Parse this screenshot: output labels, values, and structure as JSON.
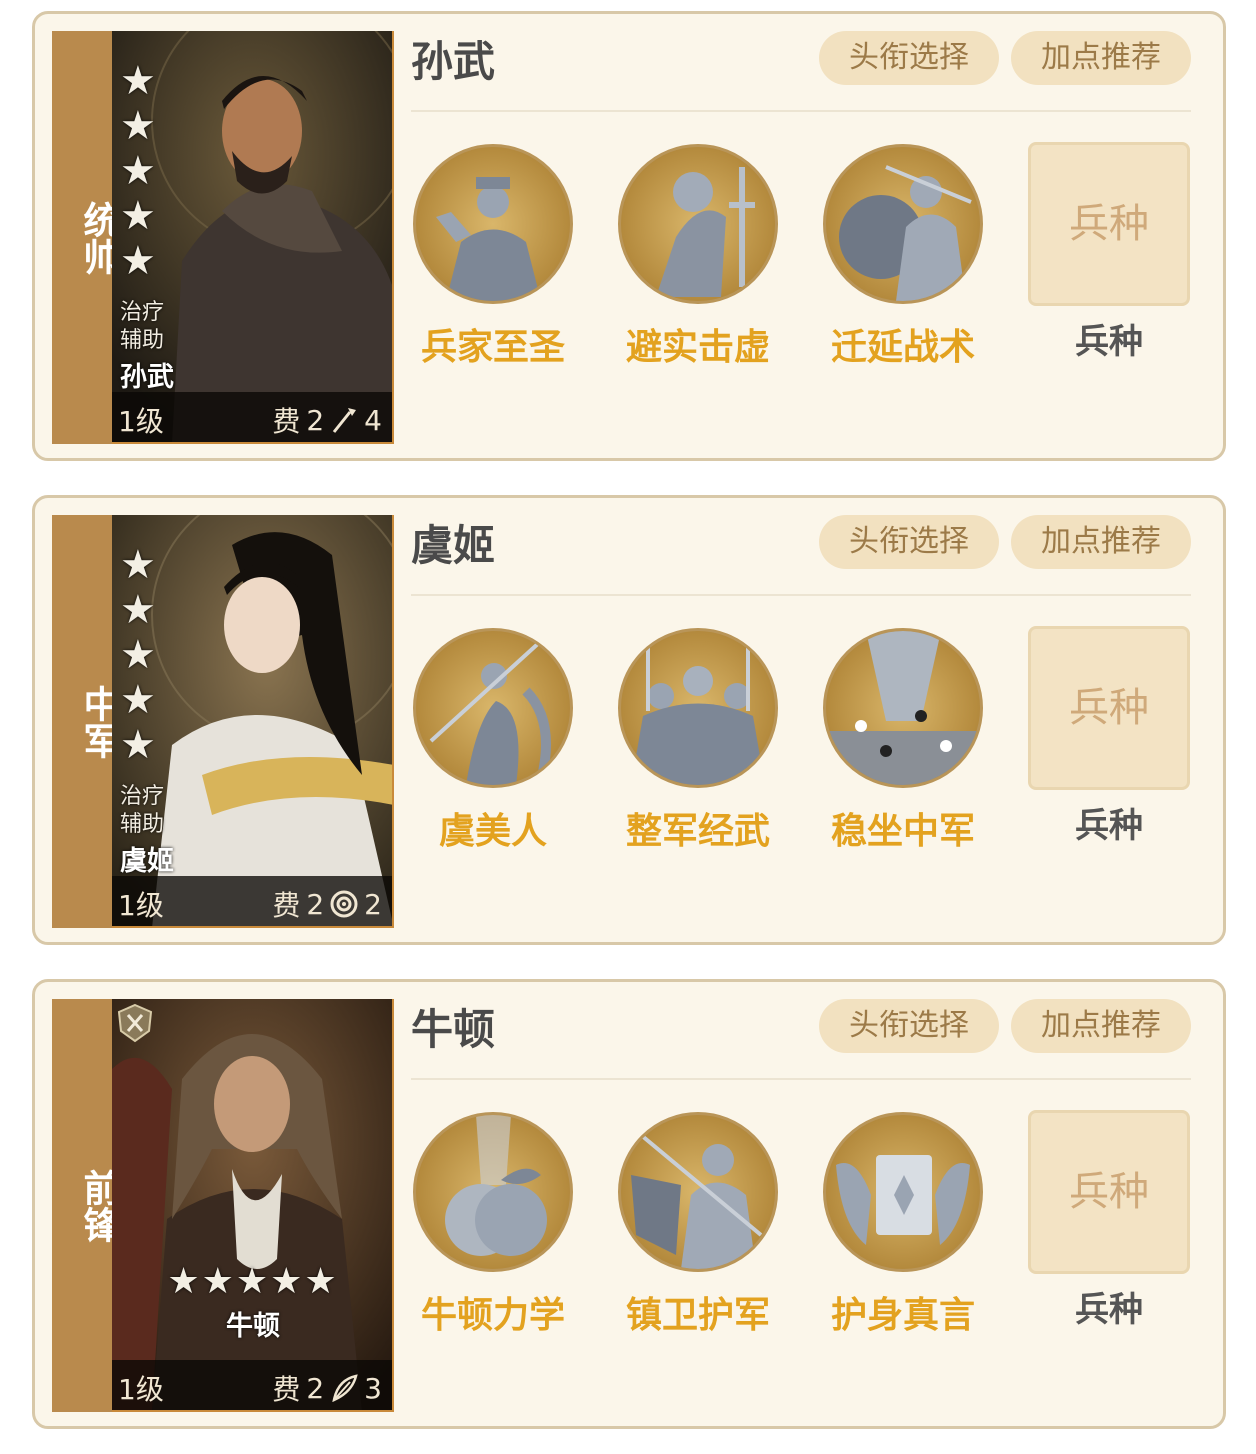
{
  "common": {
    "title_button": "头衔选择",
    "points_button": "加点推荐",
    "troop_box": "兵种",
    "troop_label": "兵种"
  },
  "heroes": [
    {
      "role": "统帅",
      "name": "孙武",
      "portrait_tags": [
        "治疗",
        "辅助"
      ],
      "portrait_name": "孙武",
      "level": "1级",
      "cost_label": "费",
      "cost": "2",
      "unit_icon": "spear-icon",
      "unit_count": "4",
      "stars": 5,
      "skills": [
        "兵家至圣",
        "避实击虚",
        "迁延战术"
      ]
    },
    {
      "role": "中军",
      "name": "虞姬",
      "portrait_tags": [
        "治疗",
        "辅助"
      ],
      "portrait_name": "虞姬",
      "level": "1级",
      "cost_label": "费",
      "cost": "2",
      "unit_icon": "target-icon",
      "unit_count": "2",
      "stars": 5,
      "skills": [
        "虞美人",
        "整军经武",
        "稳坐中军"
      ]
    },
    {
      "role": "前锋",
      "name": "牛顿",
      "portrait_name": "牛顿",
      "level": "1级",
      "cost_label": "费",
      "cost": "2",
      "unit_icon": "feather-icon",
      "unit_count": "3",
      "stars": 5,
      "skills": [
        "牛顿力学",
        "镇卫护军",
        "护身真言"
      ]
    }
  ],
  "colors": {
    "accent_gold": "#e3a21f",
    "panel_bg": "#fbf6ea",
    "role_strip": "#b98a4d",
    "pill_bg": "#f2e1c0"
  }
}
